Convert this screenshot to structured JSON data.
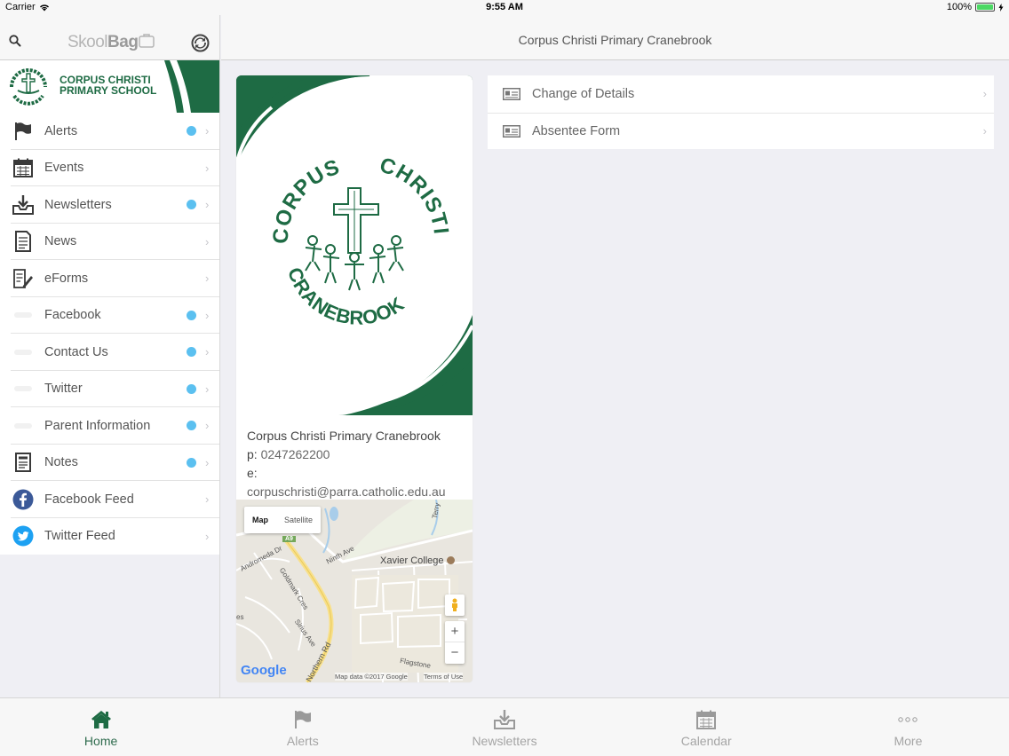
{
  "status_bar": {
    "carrier": "Carrier",
    "time": "9:55 AM",
    "battery": "100%",
    "battery_level": 1.0
  },
  "sidebar": {
    "brand_light": "Skool",
    "brand_bold": "Bag",
    "school_name_line1": "CORPUS CHRISTI",
    "school_name_line2": "PRIMARY SCHOOL",
    "items": [
      {
        "label": "Alerts",
        "icon": "flag-icon",
        "dot": true
      },
      {
        "label": "Events",
        "icon": "calendar-icon",
        "dot": false
      },
      {
        "label": "Newsletters",
        "icon": "inbox-download-icon",
        "dot": true
      },
      {
        "label": "News",
        "icon": "document-icon",
        "dot": false
      },
      {
        "label": "eForms",
        "icon": "form-edit-icon",
        "dot": false
      },
      {
        "label": "Facebook",
        "icon": "blank-icon",
        "dot": true
      },
      {
        "label": "Contact Us",
        "icon": "blank-icon",
        "dot": true
      },
      {
        "label": "Twitter",
        "icon": "blank-icon",
        "dot": true
      },
      {
        "label": "Parent Information",
        "icon": "blank-icon",
        "dot": true
      },
      {
        "label": "Notes",
        "icon": "notes-icon",
        "dot": true
      },
      {
        "label": "Facebook Feed",
        "icon": "facebook-icon",
        "dot": false
      },
      {
        "label": "Twitter Feed",
        "icon": "twitter-icon",
        "dot": false
      }
    ]
  },
  "header": {
    "title": "Corpus Christi Primary Cranebrook"
  },
  "card": {
    "logo_top_word": "CORPUS",
    "logo_right_word": "CHRISTI",
    "logo_bottom_word": "CRANEBROOK",
    "school_name": "Corpus Christi Primary Cranebrook",
    "phone_label": "p:",
    "phone": "0247262200",
    "email_label": "e:",
    "email": "corpuschristi@parra.catholic.edu.au"
  },
  "map": {
    "map_tab": "Map",
    "satellite_tab": "Satellite",
    "place": "Xavier College",
    "road_badge": "A9",
    "streets": [
      "Andromeda Dr",
      "Goldmark Cres",
      "Ninth Ave",
      "Sirius Ave",
      "Northern Rd",
      "Flagstone",
      "Terry",
      "es"
    ],
    "google": "Google",
    "attribution": "Map data ©2017 Google",
    "terms": "Terms of Use",
    "zoom_in": "+",
    "zoom_out": "−"
  },
  "forms": [
    {
      "label": "Change of Details"
    },
    {
      "label": "Absentee Form"
    }
  ],
  "tabbar": [
    {
      "label": "Home",
      "icon": "home-icon",
      "active": true
    },
    {
      "label": "Alerts",
      "icon": "flag-icon",
      "active": false
    },
    {
      "label": "Newsletters",
      "icon": "inbox-download-icon",
      "active": false
    },
    {
      "label": "Calendar",
      "icon": "calendar-icon",
      "active": false
    },
    {
      "label": "More",
      "icon": "more-dots-icon",
      "active": false
    }
  ],
  "colors": {
    "school_green": "#1e6b44",
    "dot_blue": "#5bc0f0",
    "facebook": "#3b5998",
    "twitter": "#1da1f2"
  }
}
